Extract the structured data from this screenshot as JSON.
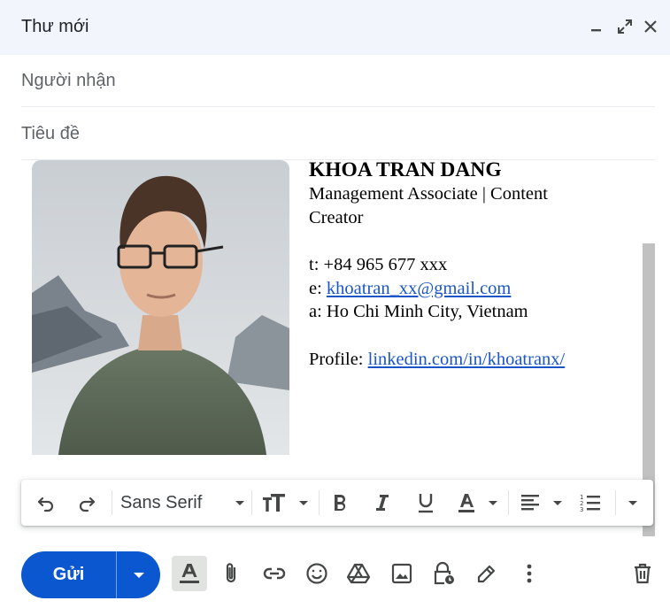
{
  "window": {
    "title": "Thư mới",
    "controls": [
      "minimize-icon",
      "expand-icon",
      "close-icon"
    ]
  },
  "fields": {
    "to_placeholder": "Người nhận",
    "subject_placeholder": "Tiêu đề"
  },
  "signature": {
    "name": "KHOA TRAN DANG",
    "role": "Management Associate | Content Creator",
    "phone_label": "t:",
    "phone": "+84 965 677 xxx",
    "email_label": "e:",
    "email": "khoatran_xx@gmail.com",
    "address_label": "a:",
    "address": "Ho Chi Minh City, Vietnam",
    "profile_label": "Profile:",
    "profile_link": "linkedin.com/in/khoatranx/"
  },
  "formatting_toolbar": {
    "font": "Sans Serif",
    "icons": [
      "undo-icon",
      "redo-icon",
      "text-size-icon",
      "bold-icon",
      "italic-icon",
      "underline-icon",
      "text-color-icon",
      "align-icon",
      "numbered-list-icon",
      "more-formatting-icon"
    ]
  },
  "bottom_toolbar": {
    "send_label": "Gửi",
    "icons": [
      "formatting-options-icon",
      "attach-icon",
      "link-icon",
      "emoji-icon",
      "drive-icon",
      "image-icon",
      "confidential-icon",
      "signature-icon",
      "more-options-icon",
      "discard-icon"
    ]
  },
  "colors": {
    "titlebar_bg": "#f2f6fc",
    "send_button": "#0b57d0",
    "link": "#1a55c8"
  }
}
